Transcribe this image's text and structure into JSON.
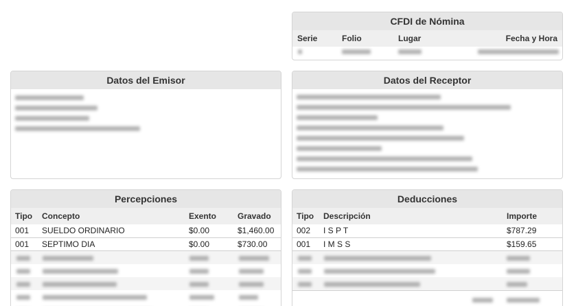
{
  "cfdi": {
    "title": "CFDI de Nómina",
    "columns": [
      "Serie",
      "Folio",
      "Lugar",
      "Fecha y Hora"
    ]
  },
  "emisor": {
    "title": "Datos del Emisor"
  },
  "receptor": {
    "title": "Datos del Receptor"
  },
  "percepciones": {
    "title": "Percepciones",
    "columns": [
      "Tipo",
      "Concepto",
      "Exento",
      "Gravado"
    ],
    "rows": [
      {
        "tipo": "001",
        "concepto": "SUELDO ORDINARIO",
        "exento": "$0.00",
        "gravado": "$1,460.00"
      },
      {
        "tipo": "001",
        "concepto": "SEPTIMO DIA",
        "exento": "$0.00",
        "gravado": "$730.00"
      }
    ]
  },
  "deducciones": {
    "title": "Deducciones",
    "columns": [
      "Tipo",
      "Descripción",
      "Importe"
    ],
    "rows": [
      {
        "tipo": "002",
        "descripcion": "I S P T",
        "importe": "$787.29"
      },
      {
        "tipo": "001",
        "descripcion": "I M S S",
        "importe": "$159.65"
      }
    ]
  }
}
